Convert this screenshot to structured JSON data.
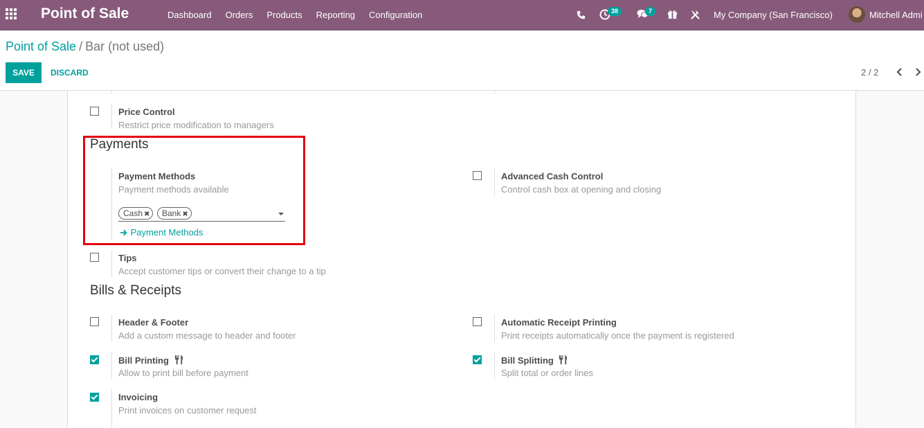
{
  "navbar": {
    "app_title": "Point of Sale",
    "menu": [
      "Dashboard",
      "Orders",
      "Products",
      "Reporting",
      "Configuration"
    ],
    "activity_count": "38",
    "message_count": "7",
    "company": "My Company (San Francisco)",
    "user": "Mitchell Admi",
    "colors": {
      "bar": "#875a7b",
      "badge": "#00a09d"
    }
  },
  "breadcrumb": {
    "parent": "Point of Sale",
    "separator": "/",
    "current": "Bar (not used)"
  },
  "buttons": {
    "save": "SAVE",
    "discard": "DISCARD"
  },
  "pager": {
    "value": "2 / 2"
  },
  "sections": {
    "payments": "Payments",
    "bills_receipts": "Bills & Receipts"
  },
  "settings": {
    "price_control": {
      "label": "Price Control",
      "desc": "Restrict price modification to managers",
      "checked": false
    },
    "payment_methods": {
      "label": "Payment Methods",
      "desc": "Payment methods available",
      "tags": [
        "Cash",
        "Bank"
      ],
      "link": "Payment Methods"
    },
    "advanced_cash_control": {
      "label": "Advanced Cash Control",
      "desc": "Control cash box at opening and closing",
      "checked": false
    },
    "tips": {
      "label": "Tips",
      "desc": "Accept customer tips or convert their change to a tip",
      "checked": false
    },
    "header_footer": {
      "label": "Header & Footer",
      "desc": "Add a custom message to header and footer",
      "checked": false
    },
    "auto_receipt": {
      "label": "Automatic Receipt Printing",
      "desc": "Print receipts automatically once the payment is registered",
      "checked": false
    },
    "bill_printing": {
      "label": "Bill Printing",
      "desc": "Allow to print bill before payment",
      "checked": true
    },
    "bill_splitting": {
      "label": "Bill Splitting",
      "desc": "Split total or order lines",
      "checked": true
    },
    "invoicing": {
      "label": "Invoicing",
      "desc": "Print invoices on customer request",
      "checked": true
    }
  },
  "icons": {
    "apps": "grid-icon",
    "phone": "phone-icon",
    "activity": "clock-icon",
    "messages": "chat-icon",
    "gift": "gift-icon",
    "debug": "tools-icon",
    "restaurant": "fork-knife-icon"
  },
  "accent_color": "#00a09d",
  "highlight_color": "#e3000f"
}
